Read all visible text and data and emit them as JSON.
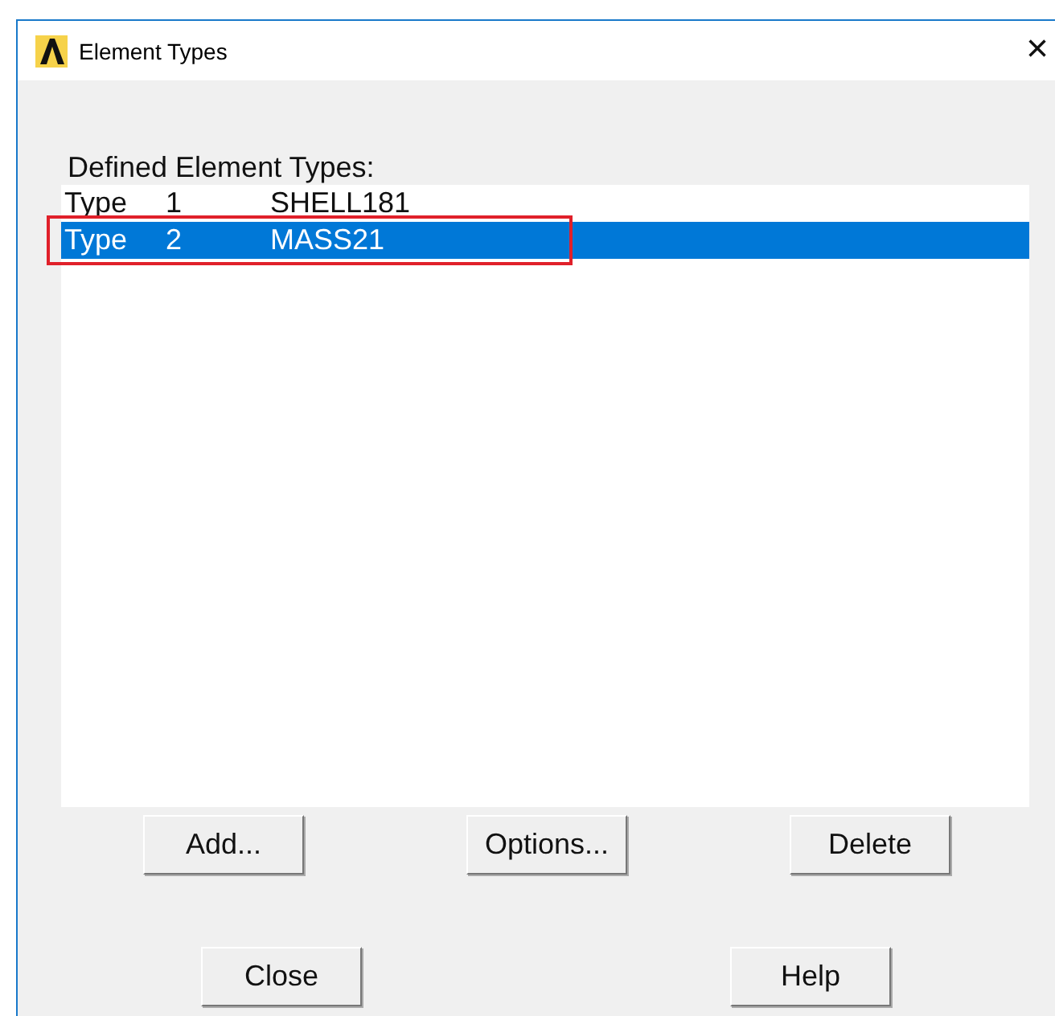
{
  "window": {
    "title": "Element Types",
    "close": "×"
  },
  "list": {
    "label": "Defined Element Types:",
    "rows": [
      {
        "type": "Type",
        "number": "1",
        "name": "SHELL181",
        "selected": false,
        "annotated": false
      },
      {
        "type": "Type",
        "number": "2",
        "name": "MASS21",
        "selected": true,
        "annotated": true
      }
    ]
  },
  "buttons": [
    [
      "Add...",
      "Options...",
      "Delete"
    ],
    [
      "Close",
      "Help"
    ]
  ]
}
